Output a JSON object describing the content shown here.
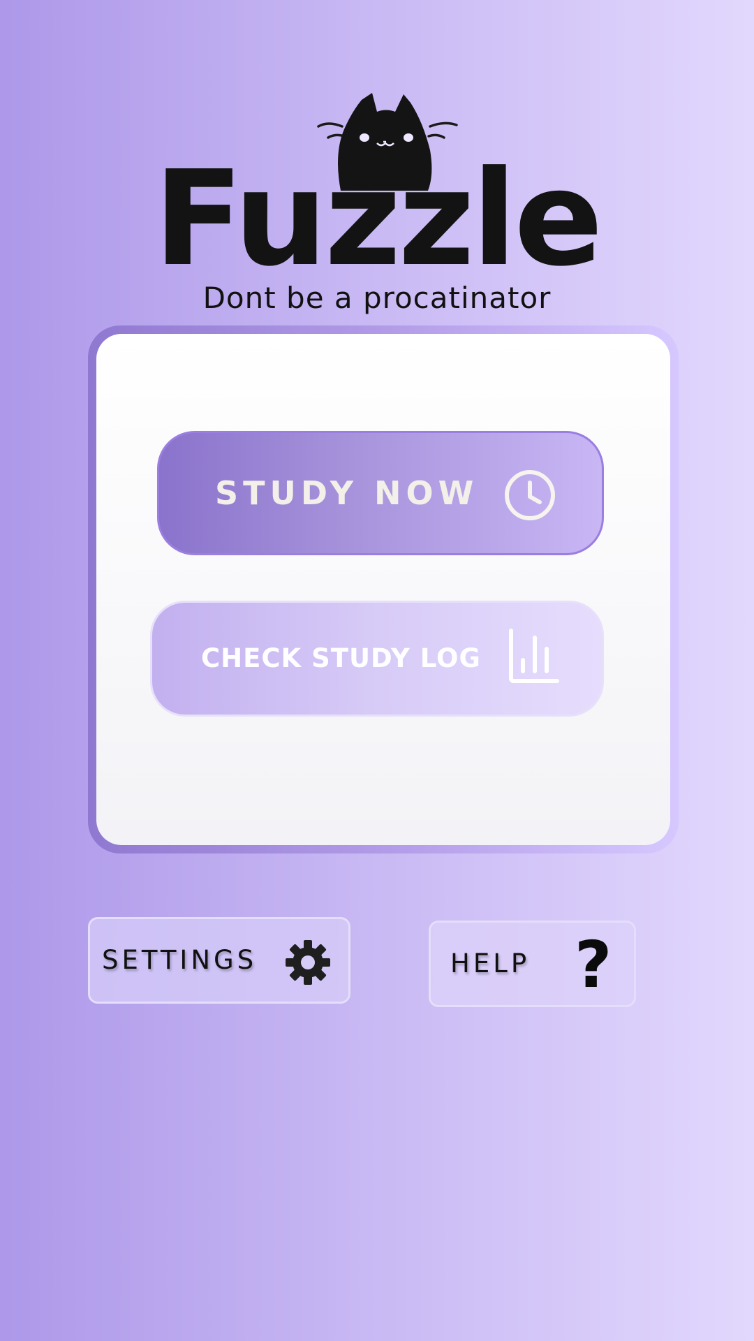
{
  "app": {
    "name": "Fuzzle",
    "tagline": "Dont be a procatinator",
    "logo_icon": "cat-icon"
  },
  "main_card": {
    "study_button": {
      "label": "STUDY NOW",
      "icon": "clock-icon"
    },
    "log_button": {
      "label": "CHECK STUDY LOG",
      "icon": "bar-chart-icon"
    }
  },
  "footer": {
    "settings_button": {
      "label": "SETTINGS",
      "icon": "gear-icon"
    },
    "help_button": {
      "label": "HELP",
      "icon": "question-mark-icon",
      "glyph": "?"
    }
  },
  "colors": {
    "background_start": "#ad98e9",
    "background_end": "#e2d8fd",
    "primary_button": "#8a73cc",
    "text_dark": "#131313",
    "button_text_light": "#f3efe9"
  }
}
